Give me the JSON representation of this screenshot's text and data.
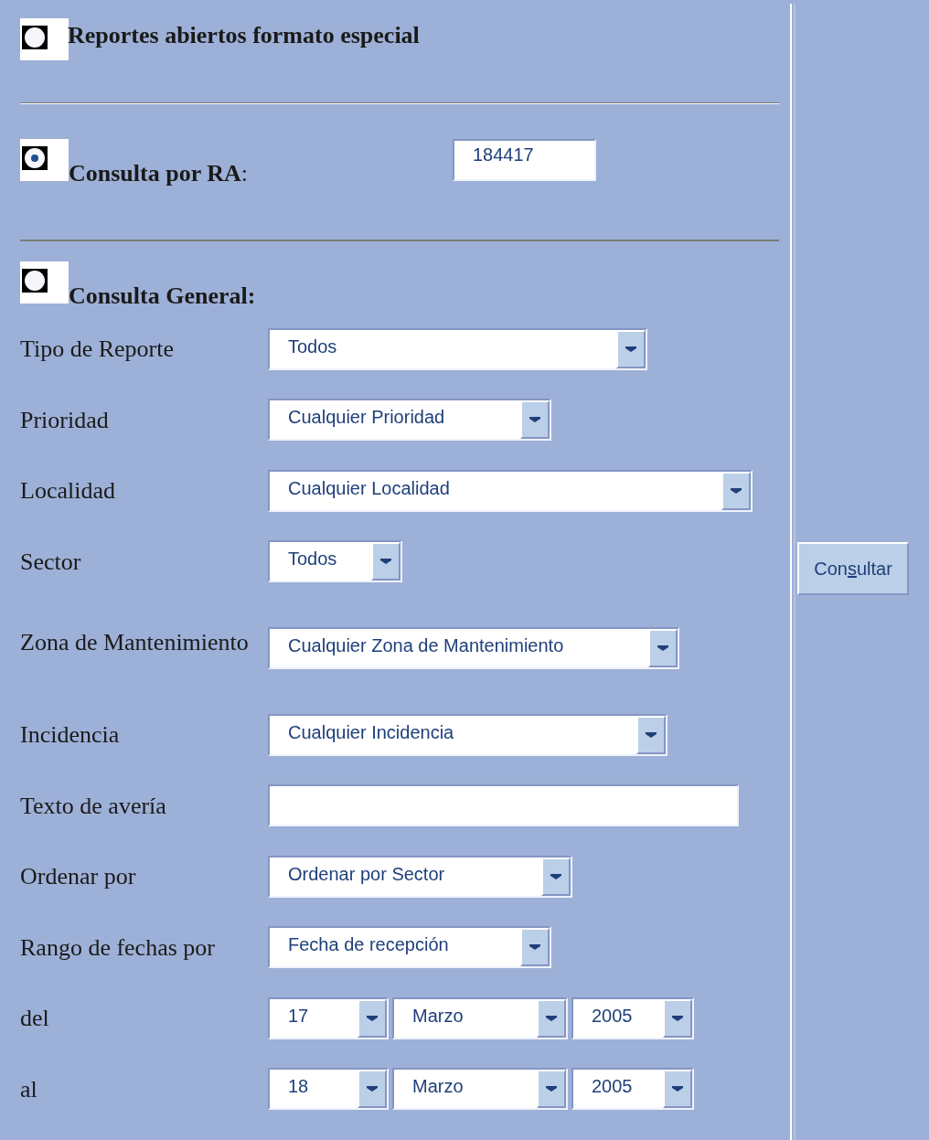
{
  "options": [
    {
      "label": "**Reportes abiertos formato especial**",
      "selected": false
    },
    {
      "label": "**Consulta por RA**:",
      "selected": true,
      "value": "184417"
    },
    {
      "label": "**Consulta General:**",
      "selected": false
    }
  ],
  "fields": [
    {
      "kind": "select",
      "label": "Tipo de Reporte",
      "value": "Todos"
    },
    {
      "kind": "select",
      "label": "Prioridad",
      "value": "Cualquier Prioridad"
    },
    {
      "kind": "select",
      "label": "Localidad",
      "value": "Cualquier Localidad"
    },
    {
      "kind": "select",
      "label": "Sector",
      "value": "Todos"
    },
    {
      "kind": "select",
      "label": "Zona de Mantenimiento",
      "value": "Cualquier Zona de Mantenimiento"
    },
    {
      "kind": "select",
      "label": "Incidencia",
      "value": "Cualquier Incidencia"
    },
    {
      "kind": "text",
      "label": "Texto de avería"
    },
    {
      "kind": "select",
      "label": "Ordenar por",
      "value": "Ordenar por Sector"
    },
    {
      "kind": "select",
      "label": "Rango de fechas por",
      "value": "Fecha de recepción"
    },
    {
      "kind": "date",
      "label": "del",
      "day": "17",
      "month": "Marzo",
      "year": "2005"
    },
    {
      "kind": "date",
      "label": "al",
      "day": "18",
      "month": "Marzo",
      "year": "2005"
    }
  ],
  "submit": {
    "label": "Con**s**ultar"
  }
}
